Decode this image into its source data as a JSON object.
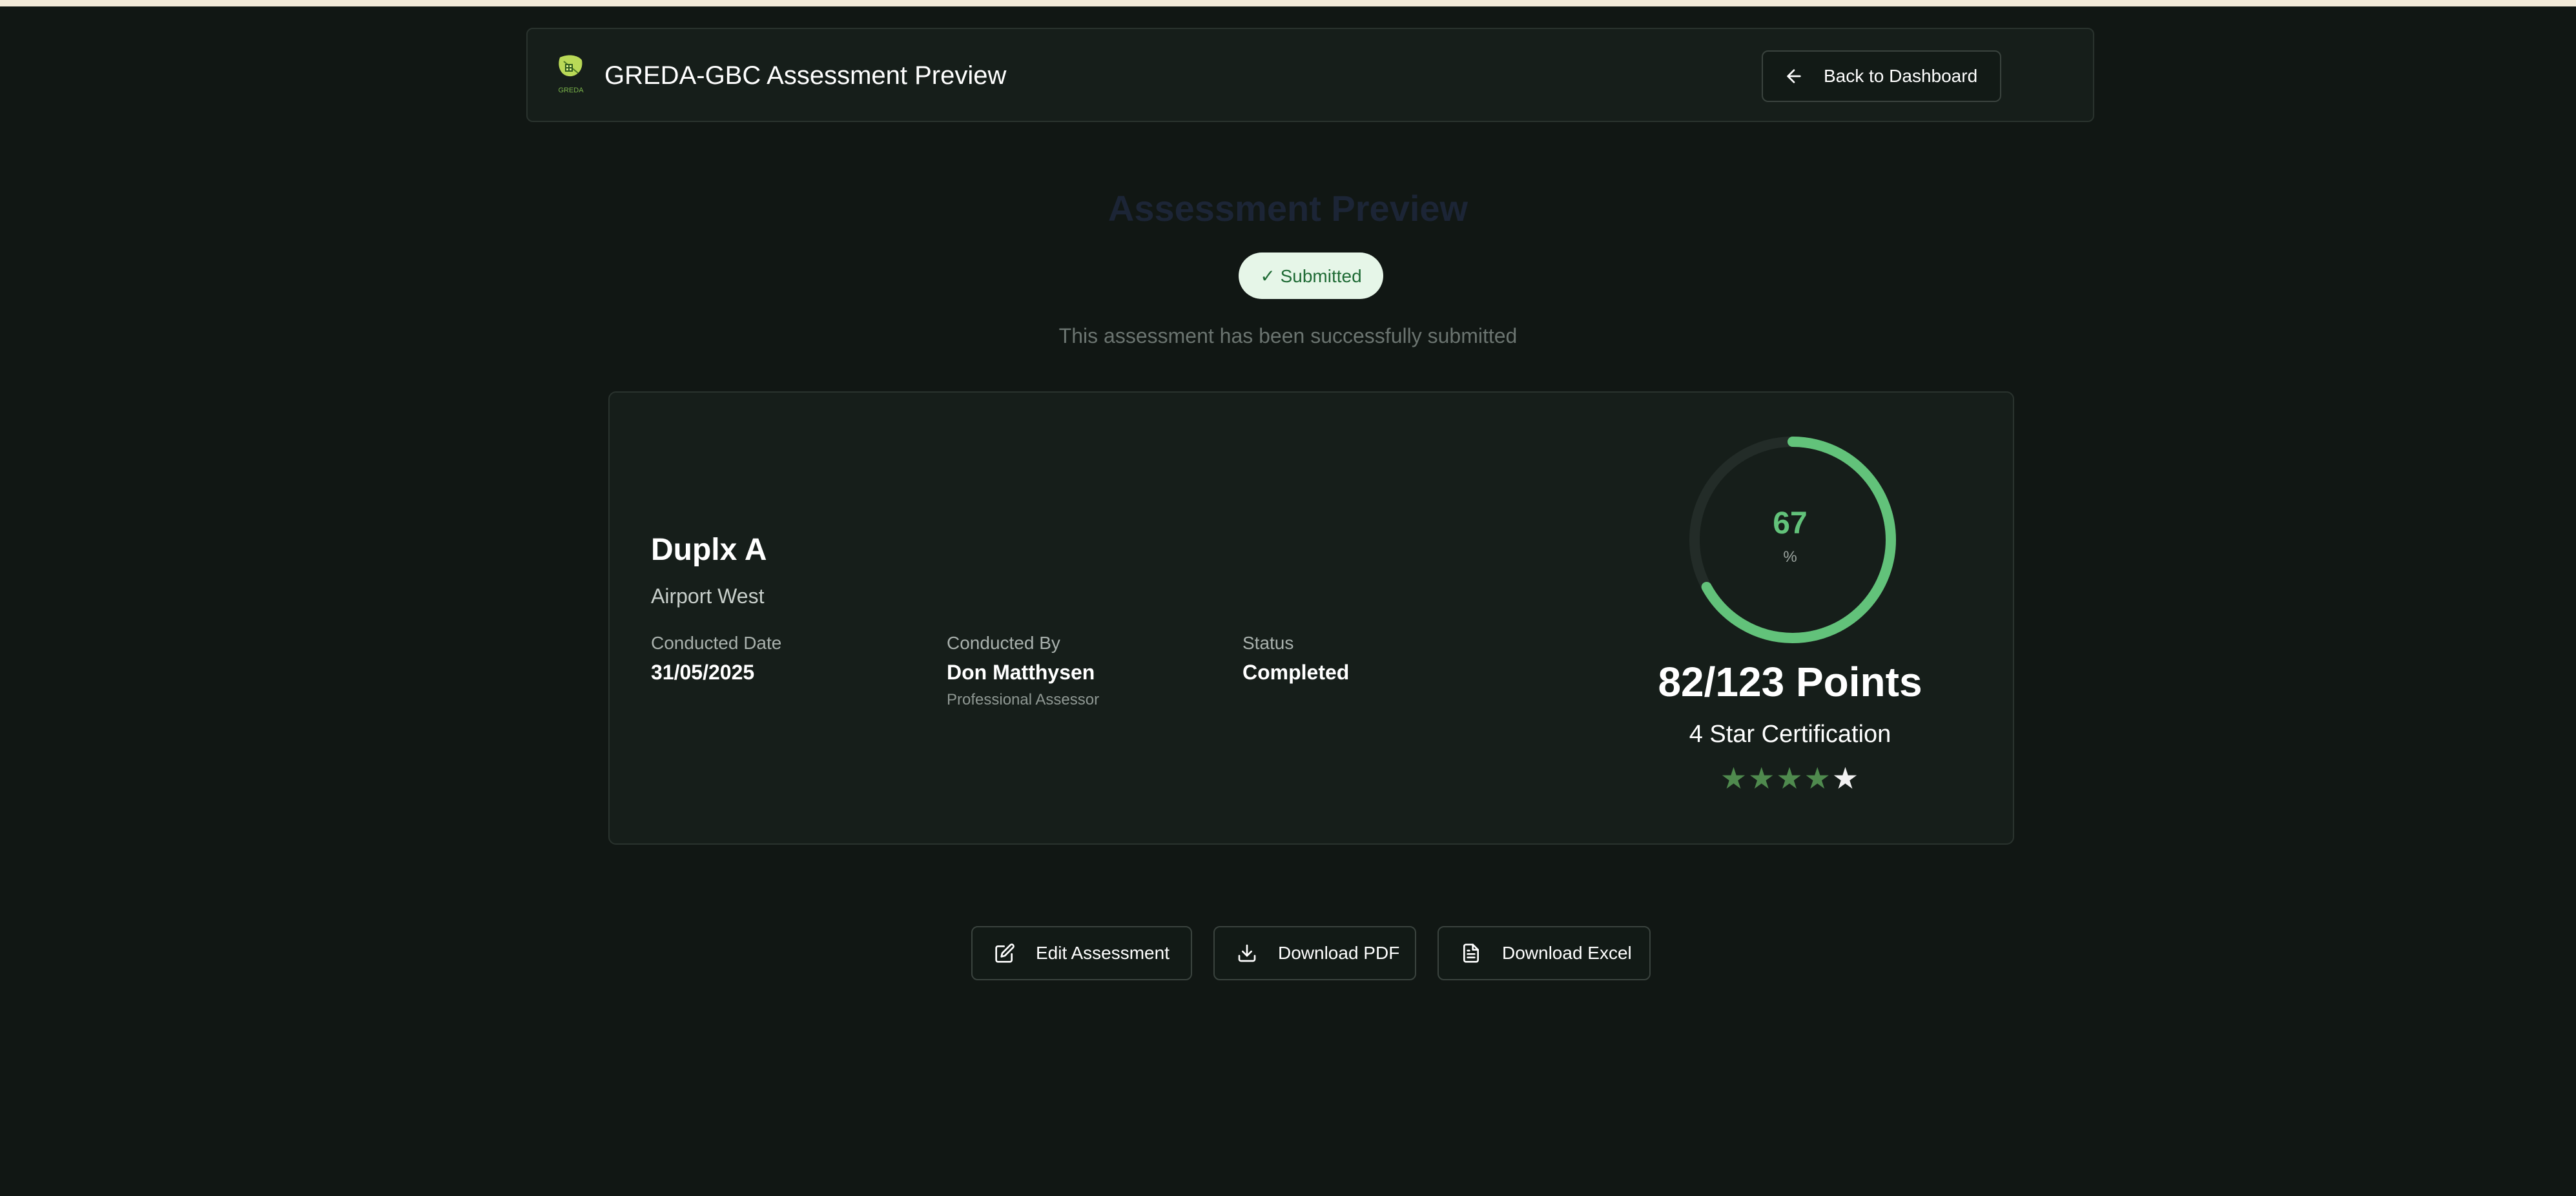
{
  "header": {
    "title": "GREDA-GBC Assessment Preview",
    "logo_text": "GREDA",
    "back_button_label": "Back to Dashboard"
  },
  "page": {
    "title": "Assessment Preview",
    "status_badge": "✓ Submitted",
    "status_message": "This assessment has been successfully submitted"
  },
  "project": {
    "name": "Duplx A",
    "location": "Airport West",
    "conducted_date_label": "Conducted Date",
    "conducted_date": "31/05/2025",
    "conducted_by_label": "Conducted By",
    "conducted_by": "Don Matthysen",
    "conducted_by_role": "Professional Assessor",
    "status_label": "Status",
    "status": "Completed"
  },
  "score": {
    "percent": "67",
    "percent_unit": "%",
    "points_text": "82/123 Points",
    "certification": "4 Star Certification",
    "stars_earned": 4,
    "stars_total": 5
  },
  "actions": {
    "edit_label": "Edit Assessment",
    "pdf_label": "Download PDF",
    "excel_label": "Download Excel"
  },
  "colors": {
    "background": "#111714",
    "accent_green": "#62c27a",
    "star_active": "#4f8a4e",
    "badge_bg": "#e6f6e8",
    "badge_text": "#1f6b35"
  },
  "icons": {
    "back": "arrow-left-icon",
    "edit": "edit-icon",
    "pdf": "download-icon",
    "excel": "file-text-icon",
    "logo": "leaf-logo-icon"
  }
}
